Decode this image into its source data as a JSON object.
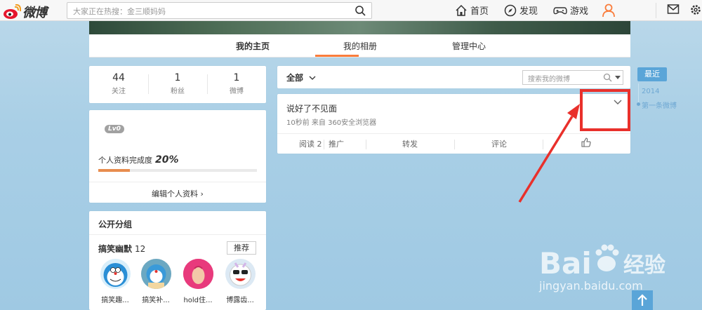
{
  "topbar": {
    "logo_text": "微博",
    "search_placeholder": "大家正在热搜：金三顺妈妈",
    "nav": {
      "home": "首页",
      "discover": "发现",
      "games": "游戏"
    }
  },
  "profile_tabs": [
    "我的主页",
    "我的相册",
    "管理中心"
  ],
  "stats": [
    {
      "num": "44",
      "label": "关注"
    },
    {
      "num": "1",
      "label": "粉丝"
    },
    {
      "num": "1",
      "label": "微博"
    }
  ],
  "profile": {
    "level": "Lv0",
    "completion_label": "个人资料完成度",
    "completion_value": "20%",
    "completion_fraction": 0.2,
    "edit_label": "编辑个人资料 ›"
  },
  "groups": {
    "title": "公开分组",
    "group_name": "搞笑幽默",
    "group_count": "12",
    "recommend": "推荐",
    "members": [
      "搞笑趣...",
      "搞笑补...",
      "hold住...",
      "博露齿..."
    ]
  },
  "feed": {
    "filter_label": "全部",
    "search_placeholder": "搜索我的微博",
    "post": {
      "text": "说好了不见面",
      "meta": "10秒前 来自 360安全浏览器",
      "reads": "阅读 2",
      "promote": "推广",
      "repost": "转发",
      "comment": "评论"
    }
  },
  "timeline": {
    "recent": "最近",
    "year": "2014",
    "first": "第一条微博"
  },
  "watermark": {
    "brand": "Bai",
    "brand2": "经验",
    "url": "jingyan.baidu.com"
  },
  "colors": {
    "accent": "#fa7d3c",
    "annotation": "#e9302b",
    "timeline": "#5aa5d8"
  }
}
